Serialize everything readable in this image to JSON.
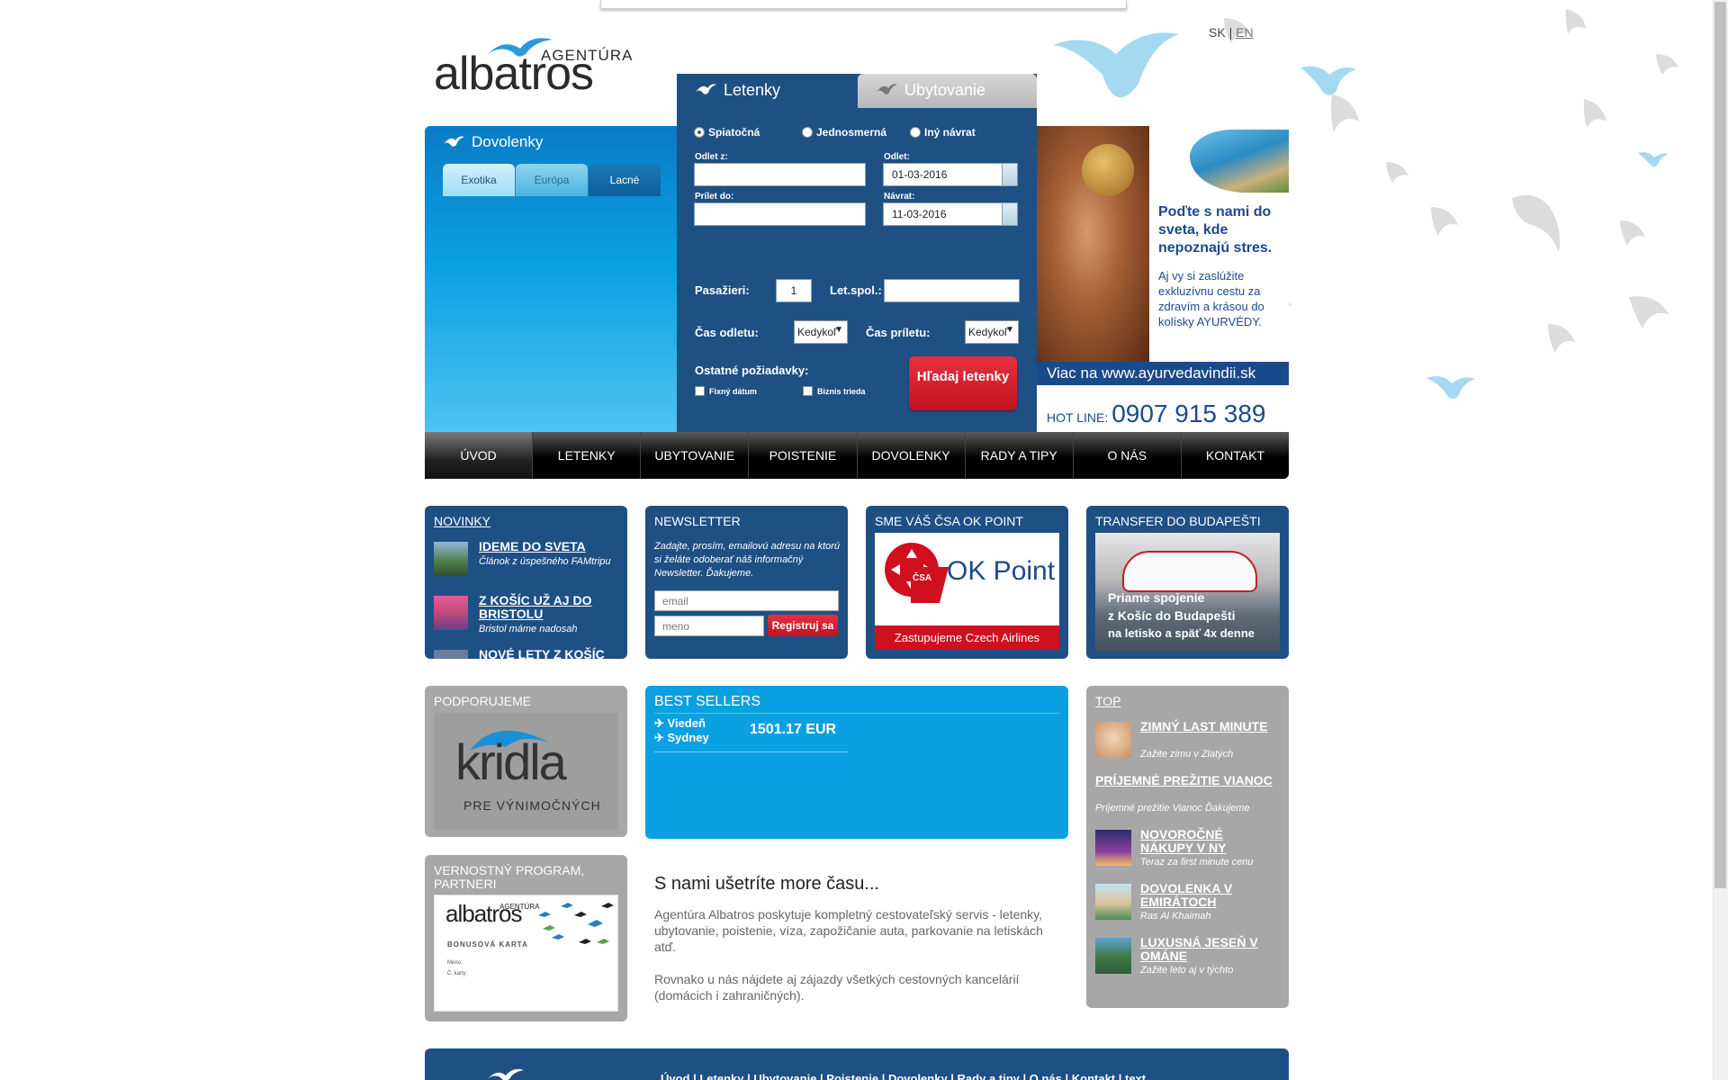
{
  "lang": {
    "sk": "SK",
    "sep": "|",
    "en": "EN"
  },
  "logo": {
    "word": "albatros",
    "sub": "AGENTÚRA"
  },
  "dovolenky": {
    "title": "Dovolenky",
    "tabs": [
      "Exotika",
      "Európa",
      "Lacné"
    ]
  },
  "tabs": {
    "letenky": "Letenky",
    "ubytovanie": "Ubytovanie"
  },
  "form": {
    "radio_options": [
      "Spiatočná",
      "Jednosmerná",
      "Iný návrat"
    ],
    "selected_radio": "Spiatočná",
    "odlet_z_label": "Odlet z:",
    "prilet_do_label": "Prílet do:",
    "odlet_label": "Odlet:",
    "odlet_value": "01-03-2016",
    "navrat_label": "Návrat:",
    "navrat_value": "11-03-2016",
    "pasazieri_label": "Pasažieri:",
    "pasazieri_value": "1",
    "letspol_label": "Let.spol.:",
    "cas_odletu_label": "Čas odletu:",
    "cas_odletu_value": "Kedykoľ",
    "cas_priletu_label": "Čas príletu:",
    "cas_priletu_value": "Kedykoľ",
    "ostatne_label": "Ostatné požiadavky:",
    "fixny": "Fixný dátum",
    "biznis": "Biznis trieda",
    "search_button": "Hľadaj letenky"
  },
  "ad": {
    "headline": "Poďte s nami do sveta, kde nepoznajú stres.",
    "body": "Aj vy si zaslúžite exkluzívnu cestu za zdravím a krásou do kolísky AYURVÉDY.",
    "url": "Viac na www.ayurvedavindii.sk",
    "hotline_label": "HOT LINE:",
    "hotline_number": "0907 915 389"
  },
  "nav": [
    "ÚVOD",
    "LETENKY",
    "UBYTOVANIE",
    "POISTENIE",
    "DOVOLENKY",
    "RADY A TIPY",
    "O NÁS",
    "KONTAKT"
  ],
  "novinky": {
    "title": "NOVINKY",
    "items": [
      {
        "title": "IDEME DO SVETA",
        "sub": "Článok z úspešného FAMtripu"
      },
      {
        "title": "Z KOŠÍC UŽ AJ DO BRISTOLU",
        "sub": "Bristol máme nadosah"
      },
      {
        "title": "NOVÉ LETY Z KOŠÍC",
        "sub": ""
      }
    ]
  },
  "newsletter": {
    "title": "NEWSLETTER",
    "text": "Zadajte, prosím, emailovú adresu na ktorú si želáte odoberať náš informačný Newsletter. Ďakujeme.",
    "email_placeholder": "email",
    "name_placeholder": "meno",
    "button": "Registruj sa"
  },
  "csa": {
    "title": "SME VÁŠ ČSA OK POINT",
    "logo_text": "OK Point",
    "logo_small": "ČSA",
    "caption": "Zastupujeme Czech Airlines"
  },
  "transfer": {
    "title": "TRANSFER DO BUDAPEŠTI",
    "line1": "Priame spojenie",
    "line2": "z Košíc do Budapešti",
    "line3": "na letisko a späť 4x denne"
  },
  "podporujeme": {
    "title": "PODPORUJEME",
    "logo": "kridla",
    "tagline": "PRE VÝNIMOČNÝCH"
  },
  "bestsellers": {
    "title": "BEST SELLERS",
    "items": [
      {
        "from": "Viedeň",
        "to": "Sydney",
        "price": "1501.17 EUR"
      }
    ]
  },
  "top": {
    "title": "TOP",
    "items": [
      {
        "title": "ZIMNÝ LAST MINUTE",
        "sub": "Zažite zimu v Zlatých"
      },
      {
        "title": "PRÍJEMNÉ PREŽITIE VIANOC",
        "sub": "Príjemné prežitie Vianoc  Ďakujeme"
      },
      {
        "title": "NOVOROČNÉ NÁKUPY V NY",
        "sub": "Teraz za first minute cenu"
      },
      {
        "title": "DOVOLENKA V EMIRÁTOCH",
        "sub": "Ras Al Khaimah"
      },
      {
        "title": "LUXUSNÁ JESEŇ V OMÁNE",
        "sub": "Zažite leto aj v týchto"
      }
    ]
  },
  "vernostny": {
    "title": "VERNOSTNÝ PROGRAM, PARTNERI",
    "card_logo": "albatros",
    "card_sub": "AGENTÚRA",
    "card_label": "BONUSOVÁ KARTA",
    "card_name": "Meno:",
    "card_no": "Č. karty:"
  },
  "usetrite": {
    "title": "S nami ušetríte more času...",
    "p1": "Agentúra Albatros poskytuje kompletný cestovateľský servis - letenky, ubytovanie, poistenie, víza, zapožičanie auta, parkovanie na letiskách atď.",
    "p2": "Rovnako u nás nájdete aj zájazdy všetkých cestovných kancelárií (domácich i zahraničných)."
  },
  "footer": {
    "links": "Úvod | Letenky | Ubytovanie | Poistenie | Dovolenky | Rady a tipy | O nás | Kontakt | text"
  },
  "colors": {
    "navy": "#1e5084",
    "cyan": "#0aa0e2",
    "red": "#d0101f",
    "grey": "#a7a7a7"
  }
}
